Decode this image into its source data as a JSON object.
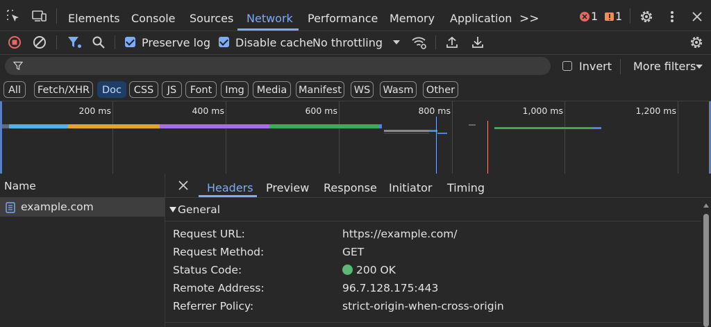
{
  "tabs": {
    "items": [
      "Elements",
      "Console",
      "Sources",
      "Network",
      "Performance",
      "Memory",
      "Application"
    ],
    "active": "Network",
    "overflow": ">>",
    "error_count": "1",
    "warning_count": "1"
  },
  "toolbar": {
    "preserve_log": "Preserve log",
    "disable_cache": "Disable cache",
    "throttling": "No throttling"
  },
  "filter": {
    "placeholder": "",
    "invert": "Invert",
    "more_filters": "More filters"
  },
  "chips": [
    "All",
    "Fetch/XHR",
    "Doc",
    "CSS",
    "JS",
    "Font",
    "Img",
    "Media",
    "Manifest",
    "WS",
    "Wasm",
    "Other"
  ],
  "active_chip": "Doc",
  "overview": {
    "ticks": [
      "200 ms",
      "400 ms",
      "600 ms",
      "800 ms",
      "1,000 ms",
      "1,200 ms"
    ]
  },
  "requests": {
    "header": "Name",
    "rows": [
      {
        "name": "example.com"
      }
    ]
  },
  "details": {
    "tabs": [
      "Headers",
      "Preview",
      "Response",
      "Initiator",
      "Timing"
    ],
    "active": "Headers",
    "section": "General",
    "rows": [
      {
        "key": "Request URL:",
        "value": "https://example.com/"
      },
      {
        "key": "Request Method:",
        "value": "GET"
      },
      {
        "key": "Status Code:",
        "value": "200 OK"
      },
      {
        "key": "Remote Address:",
        "value": "96.7.128.175:443"
      },
      {
        "key": "Referrer Policy:",
        "value": "strict-origin-when-cross-origin"
      }
    ]
  },
  "colors": {
    "accent": "#7cacf8",
    "error": "#e46962",
    "warning": "#f28b54",
    "status_ok": "#5bb974",
    "active_chip_bg": "#1d3f66"
  }
}
